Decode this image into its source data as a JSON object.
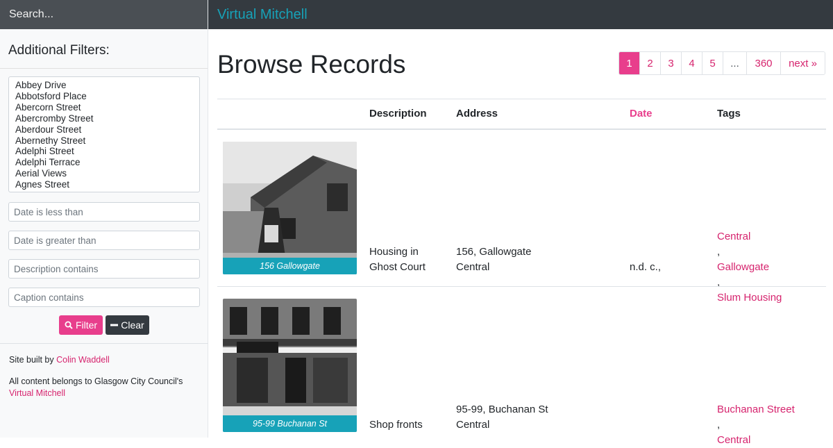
{
  "search": {
    "placeholder": "Search..."
  },
  "navbar": {
    "brand": "Virtual Mitchell"
  },
  "sidebar": {
    "filters_title": "Additional Filters:",
    "streets": [
      "Abbey Drive",
      "Abbotsford Place",
      "Abercorn Street",
      "Abercromby Street",
      "Aberdour Street",
      "Abernethy Street",
      "Adelphi Street",
      "Adelphi Terrace",
      "Aerial Views",
      "Agnes Street"
    ],
    "date_lt_placeholder": "Date is less than",
    "date_gt_placeholder": "Date is greater than",
    "description_placeholder": "Description contains",
    "caption_placeholder": "Caption contains",
    "filter_label": "Filter",
    "clear_label": "Clear",
    "footer": {
      "built_by_prefix": "Site built by ",
      "built_by_name": "Colin Waddell",
      "content_prefix": "All content belongs to Glasgow City Council's ",
      "content_link": "Virtual Mitchell"
    }
  },
  "main": {
    "title": "Browse Records",
    "pagination": [
      "1",
      "2",
      "3",
      "4",
      "5",
      "...",
      "360",
      "next »"
    ],
    "active_page": "1",
    "columns": {
      "description": "Description",
      "address": "Address",
      "date": "Date",
      "tags": "Tags"
    },
    "rows": [
      {
        "caption": "156 Gallowgate",
        "description_l1": "Housing in",
        "description_l2": "Ghost Court",
        "address_l1": "156, Gallowgate",
        "address_l2": "Central",
        "date": "n.d. c.,",
        "tags": [
          "Central",
          "Gallowgate",
          "Slum Housing"
        ]
      },
      {
        "caption": "95-99 Buchanan St",
        "description_l1": "Shop fronts",
        "address_l1": "95-99, Buchanan St",
        "address_l2": "Central",
        "date": "",
        "tags": [
          "Buchanan Street",
          "Central"
        ]
      }
    ]
  },
  "colors": {
    "accent": "#e83e8c",
    "teal": "#17a2b8",
    "dark": "#343a40"
  }
}
